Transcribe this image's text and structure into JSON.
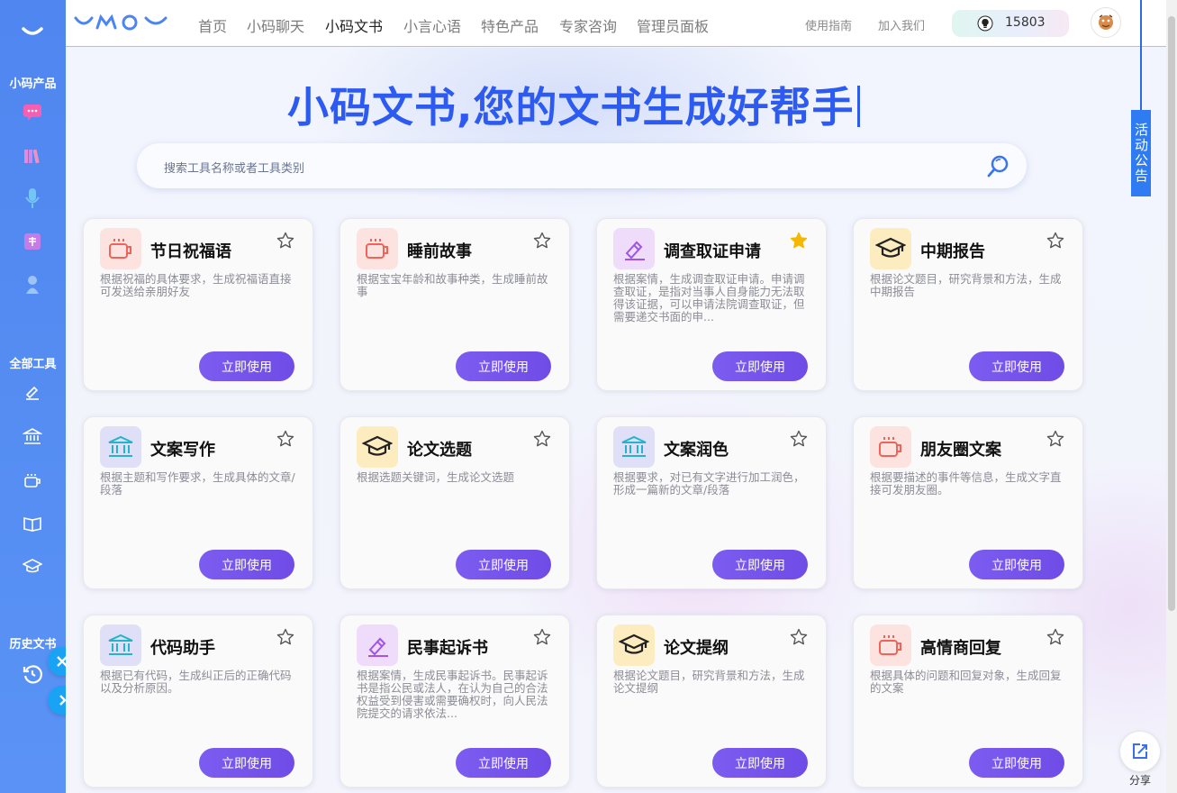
{
  "brand": {
    "name": "YMOY"
  },
  "sidebar": {
    "products_label": "小码产品",
    "tools_label": "全部工具",
    "history_label": "历史文书",
    "product_icons": [
      "chat-icon",
      "books-icon",
      "microphone-icon",
      "doc-icon",
      "expert-icon"
    ],
    "tool_icons": [
      "pen-icon",
      "bank-icon",
      "cup-icon",
      "book-icon",
      "graduation-cap-icon"
    ]
  },
  "nav": {
    "items": [
      "首页",
      "小码聊天",
      "小码文书",
      "小言心语",
      "特色产品",
      "专家咨询",
      "管理员面板"
    ],
    "active_index": 2,
    "guide": "使用指南",
    "join": "加入我们",
    "points": "15803"
  },
  "hero": {
    "title": "小码文书,您的文书生成好帮手"
  },
  "search": {
    "placeholder": "搜索工具名称或者工具类别"
  },
  "cards": [
    {
      "title": "节日祝福语",
      "desc": "根据祝福的具体要求，生成祝福语直接可发送给亲朋好友",
      "icon": "cup-icon",
      "favorited": false
    },
    {
      "title": "睡前故事",
      "desc": "根据宝宝年龄和故事种类，生成睡前故事",
      "icon": "cup-icon",
      "favorited": false
    },
    {
      "title": "调查取证申请",
      "desc": "根据案情，生成调查取证申请。申请调查取证，是指对当事人自身能力无法取得该证据，可以申请法院调查取证，但需要递交书面的申...",
      "icon": "pen-icon",
      "favorited": true
    },
    {
      "title": "中期报告",
      "desc": "根据论文题目，研究背景和方法，生成中期报告",
      "icon": "graduation-cap-icon",
      "favorited": false
    },
    {
      "title": "文案写作",
      "desc": "根据主题和写作要求，生成具体的文章/段落",
      "icon": "bank-icon",
      "favorited": false
    },
    {
      "title": "论文选题",
      "desc": "根据选题关键词，生成论文选题",
      "icon": "graduation-cap-icon",
      "favorited": false
    },
    {
      "title": "文案润色",
      "desc": "根据要求，对已有文字进行加工润色，形成一篇新的文章/段落",
      "icon": "bank-icon",
      "favorited": false
    },
    {
      "title": "朋友圈文案",
      "desc": "根据要描述的事件等信息，生成文字直接可发朋友圈。",
      "icon": "cup-icon",
      "favorited": false
    },
    {
      "title": "代码助手",
      "desc": "根据已有代码，生成纠正后的正确代码以及分析原因。",
      "icon": "bank-icon",
      "favorited": false
    },
    {
      "title": "民事起诉书",
      "desc": "根据案情，生成民事起诉书。民事起诉书是指公民或法人，在认为自己的合法权益受到侵害或需要确权时，向人民法院提交的请求依法...",
      "icon": "pen-icon",
      "favorited": false
    },
    {
      "title": "论文提纲",
      "desc": "根据论文题目，研究背景和方法，生成论文提纲",
      "icon": "graduation-cap-icon",
      "favorited": false
    },
    {
      "title": "高情商回复",
      "desc": "根据具体的问题和回复对象，生成回复的文案",
      "icon": "cup-icon",
      "favorited": false
    }
  ],
  "card_button_label": "立即使用",
  "notice": {
    "label": "活动公告"
  },
  "share": {
    "label": "分享"
  },
  "colors": {
    "accent": "#2d5af0",
    "button": "#7355ea",
    "sidebar": "#5089f1",
    "star_active": "#f5b800"
  }
}
